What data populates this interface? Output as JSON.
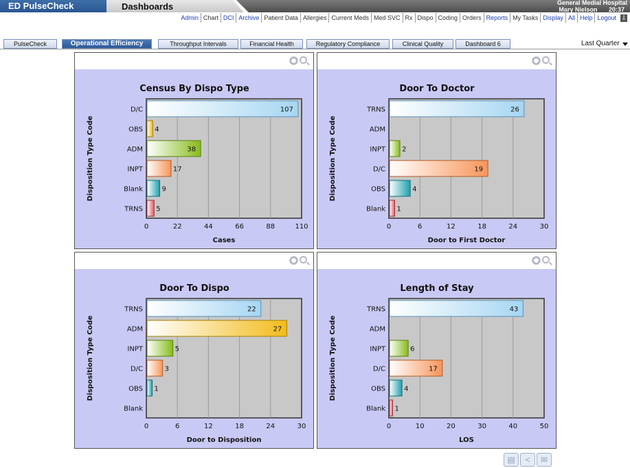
{
  "header": {
    "app_name": "ED PulseCheck",
    "section": "Dashboards",
    "hospital": "General Medial Hospital",
    "user": "Mary Nielson",
    "time": "20:37"
  },
  "links": [
    {
      "label": "Admin",
      "active": true
    },
    {
      "label": "Chart",
      "active": false
    },
    {
      "label": "DCI",
      "active": true
    },
    {
      "label": "Archive",
      "active": true
    },
    {
      "label": "Patient Data",
      "active": false
    },
    {
      "label": "Allergies",
      "active": false
    },
    {
      "label": "Current Meds",
      "active": false
    },
    {
      "label": "Med SVC",
      "active": false
    },
    {
      "label": "Rx",
      "active": false
    },
    {
      "label": "Dispo",
      "active": false
    },
    {
      "label": "Coding",
      "active": false
    },
    {
      "label": "Orders",
      "active": false
    },
    {
      "label": "Reports",
      "active": true
    },
    {
      "label": "My Tasks",
      "active": false
    },
    {
      "label": "Display",
      "active": true
    },
    {
      "label": "All",
      "active": true
    },
    {
      "label": "Help",
      "active": true
    },
    {
      "label": "Logout",
      "active": true
    }
  ],
  "tabs": [
    {
      "label": "PulseCheck",
      "active": false
    },
    {
      "label": "Operational Efficiency",
      "active": true
    },
    {
      "label": "Throughput Intervals",
      "active": false
    },
    {
      "label": "Financial Health",
      "active": false
    },
    {
      "label": "Regulatory Compliance",
      "active": false
    },
    {
      "label": "Clinical Quality",
      "active": false
    },
    {
      "label": "Dashboard 6",
      "active": false
    }
  ],
  "period_select": {
    "value": "Last Quarter"
  },
  "colors": {
    "panel_bg": "#c9c9f5",
    "plot_bg": "#c8c8c8",
    "TRNS": "#9fd2f0",
    "D/C": "#9fd2f0",
    "OBS": "#f2c030",
    "ADM": "#8cc020",
    "INPT": "#f4a070",
    "Blank": "#2aa0b0"
  },
  "chart_data": [
    {
      "type": "bar",
      "orientation": "horizontal",
      "title": "Census By Dispo Type",
      "xlabel": "Cases",
      "ylabel": "Disposition Type Code",
      "categories": [
        "D/C",
        "OBS",
        "ADM",
        "INPT",
        "Blank",
        "TRNS"
      ],
      "values": [
        107,
        4,
        38,
        17,
        9,
        5
      ],
      "bar_colors": [
        "blue",
        "yellow",
        "green",
        "orange",
        "teal",
        "red"
      ],
      "xlim": [
        0,
        110
      ],
      "xticks": [
        "0",
        "22",
        "44",
        "66",
        "88",
        "110"
      ]
    },
    {
      "type": "bar",
      "orientation": "horizontal",
      "title": "Door To Doctor",
      "xlabel": "Door to First Doctor",
      "ylabel": "Disposition Type Code",
      "categories": [
        "TRNS",
        "ADM",
        "INPT",
        "D/C",
        "OBS",
        "Blank"
      ],
      "values": [
        26,
        0,
        2,
        19,
        4,
        1
      ],
      "value_labels": [
        "26",
        "",
        "2",
        "19",
        "4",
        "1"
      ],
      "bar_colors": [
        "blue",
        "yellow",
        "green",
        "orange",
        "teal",
        "red"
      ],
      "xlim": [
        0,
        30
      ],
      "xticks": [
        "0",
        "6",
        "12",
        "18",
        "24",
        "30"
      ]
    },
    {
      "type": "bar",
      "orientation": "horizontal",
      "title": "Door To Dispo",
      "xlabel": "Door to Disposition",
      "ylabel": "Disposition Type Code",
      "categories": [
        "TRNS",
        "ADM",
        "INPT",
        "D/C",
        "OBS",
        "Blank"
      ],
      "values": [
        22,
        27,
        5,
        3,
        1,
        0
      ],
      "value_labels": [
        "22",
        "27",
        "5",
        "3",
        "1",
        ""
      ],
      "bar_colors": [
        "blue",
        "yellow",
        "green",
        "orange",
        "teal",
        "red"
      ],
      "xlim": [
        0,
        30
      ],
      "xticks": [
        "0",
        "6",
        "12",
        "18",
        "24",
        "30"
      ]
    },
    {
      "type": "bar",
      "orientation": "horizontal",
      "title": "Length of Stay",
      "xlabel": "LOS",
      "ylabel": "Disposition Type Code",
      "categories": [
        "TRNS",
        "ADM",
        "INPT",
        "D/C",
        "OBS",
        "Blank"
      ],
      "values": [
        43,
        0,
        6,
        17,
        4,
        1
      ],
      "value_labels": [
        "43",
        "",
        "6",
        "17",
        "4",
        "1"
      ],
      "bar_colors": [
        "blue",
        "yellow",
        "green",
        "orange",
        "teal",
        "red"
      ],
      "xlim": [
        0,
        50
      ],
      "xticks": [
        "0",
        "10",
        "20",
        "30",
        "40",
        "50"
      ]
    }
  ],
  "footer_icons": [
    "print-icon",
    "share-icon",
    "email-icon"
  ]
}
